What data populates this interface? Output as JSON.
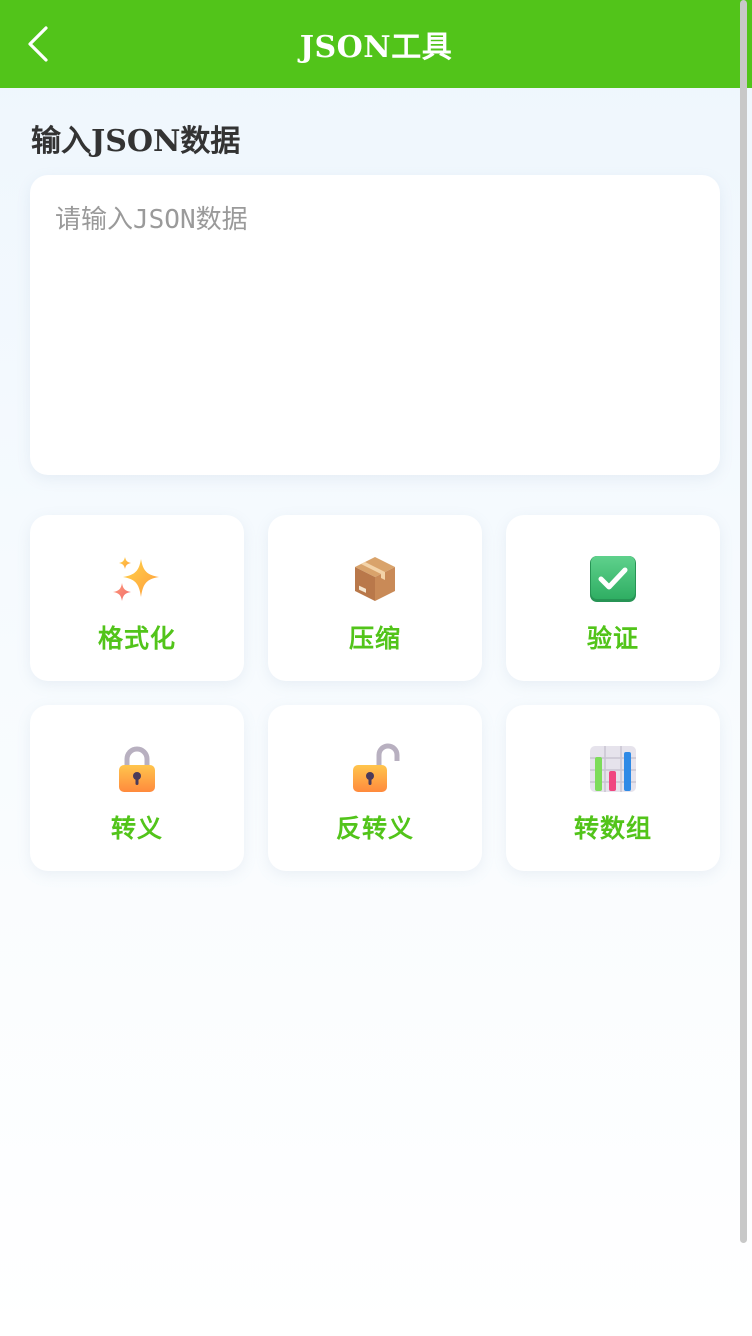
{
  "header": {
    "title": "JSON工具",
    "back_icon": "chevron-left-icon"
  },
  "input_section": {
    "title": "输入JSON数据",
    "placeholder": "请输入JSON数据",
    "value": ""
  },
  "tools": [
    {
      "label": "格式化",
      "icon": "sparkles-icon"
    },
    {
      "label": "压缩",
      "icon": "package-icon"
    },
    {
      "label": "验证",
      "icon": "check-box-icon"
    },
    {
      "label": "转义",
      "icon": "locked-icon"
    },
    {
      "label": "反转义",
      "icon": "unlocked-icon"
    },
    {
      "label": "转数组",
      "icon": "bar-chart-icon"
    }
  ],
  "colors": {
    "accent": "#52c41a",
    "title_text": "#333333",
    "placeholder": "#9a9a9a"
  }
}
